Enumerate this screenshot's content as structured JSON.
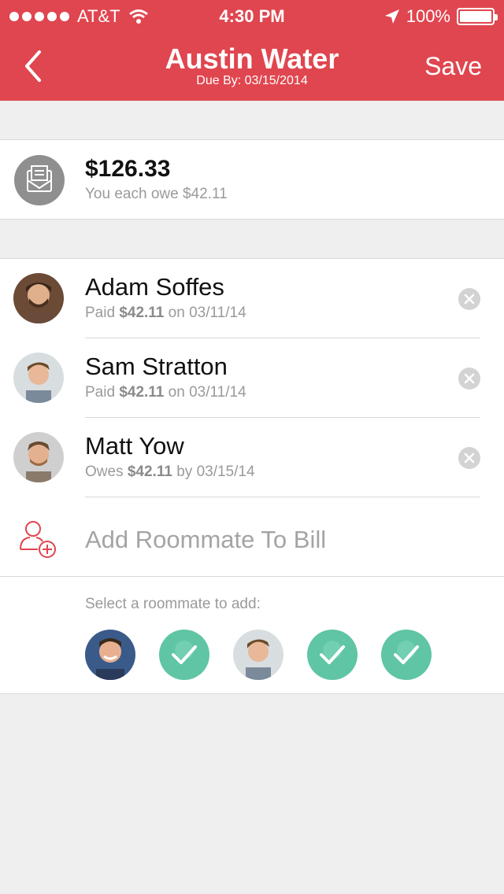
{
  "status_bar": {
    "carrier": "AT&T",
    "time": "4:30 PM",
    "battery": "100%"
  },
  "nav": {
    "title": "Austin Water",
    "subtitle": "Due By: 03/15/2014",
    "save_label": "Save"
  },
  "bill": {
    "amount": "$126.33",
    "each_owe": "You each owe $42.11"
  },
  "roommates": [
    {
      "name": "Adam Soffes",
      "status_prefix": "Paid",
      "amount": "$42.11",
      "status_suffix": "on 03/11/14"
    },
    {
      "name": "Sam Stratton",
      "status_prefix": "Paid",
      "amount": "$42.11",
      "status_suffix": "on 03/11/14"
    },
    {
      "name": "Matt Yow",
      "status_prefix": "Owes",
      "amount": "$42.11",
      "status_suffix": "by 03/15/14"
    }
  ],
  "add_roommate": {
    "label": "Add Roommate To Bill",
    "select_prompt": "Select a roommate to add:"
  },
  "picker": [
    {
      "selected": false
    },
    {
      "selected": true
    },
    {
      "selected": false
    },
    {
      "selected": true
    },
    {
      "selected": true
    }
  ],
  "colors": {
    "accent": "#e0464f",
    "selected": "#5fc5a4",
    "muted_text": "#9a9a9a"
  }
}
